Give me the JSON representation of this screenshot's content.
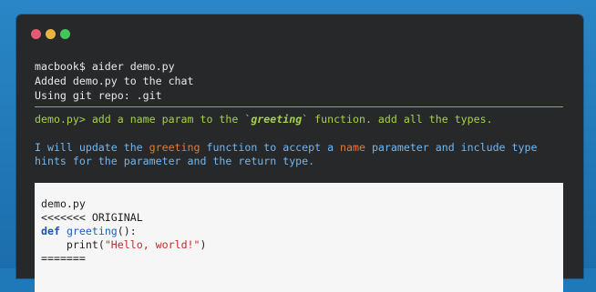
{
  "colors": {
    "background": "#1f78b8",
    "terminal_bg": "#26282a",
    "prompt": "#a6d14a",
    "reply": "#73b7f0",
    "highlight": "#e07a3f"
  },
  "window": {
    "controls": [
      "close",
      "minimize",
      "zoom"
    ]
  },
  "terminal": {
    "cmd": "macbook$ aider demo.py",
    "added": "Added demo.py to the chat",
    "repo": "Using git repo: .git",
    "prompt_prefix": "demo.py> add a name param to the `",
    "prompt_bold": "greeting",
    "prompt_suffix": "` function. add all the types.",
    "reply_a": "I will update the ",
    "reply_hl1": "greeting",
    "reply_b": " function to accept a ",
    "reply_hl2": "name",
    "reply_c": " parameter and include type",
    "reply_line2": "hints for the parameter and the return type."
  },
  "code": {
    "filename": "demo.py",
    "marker_start": "<<<<<<< ORIGINAL",
    "def_kw": "def",
    "func_name": "greeting",
    "def_rest": "():",
    "print_prefix": "    print(",
    "print_string": "\"Hello, world!\"",
    "print_suffix": ")",
    "separator": "======="
  }
}
